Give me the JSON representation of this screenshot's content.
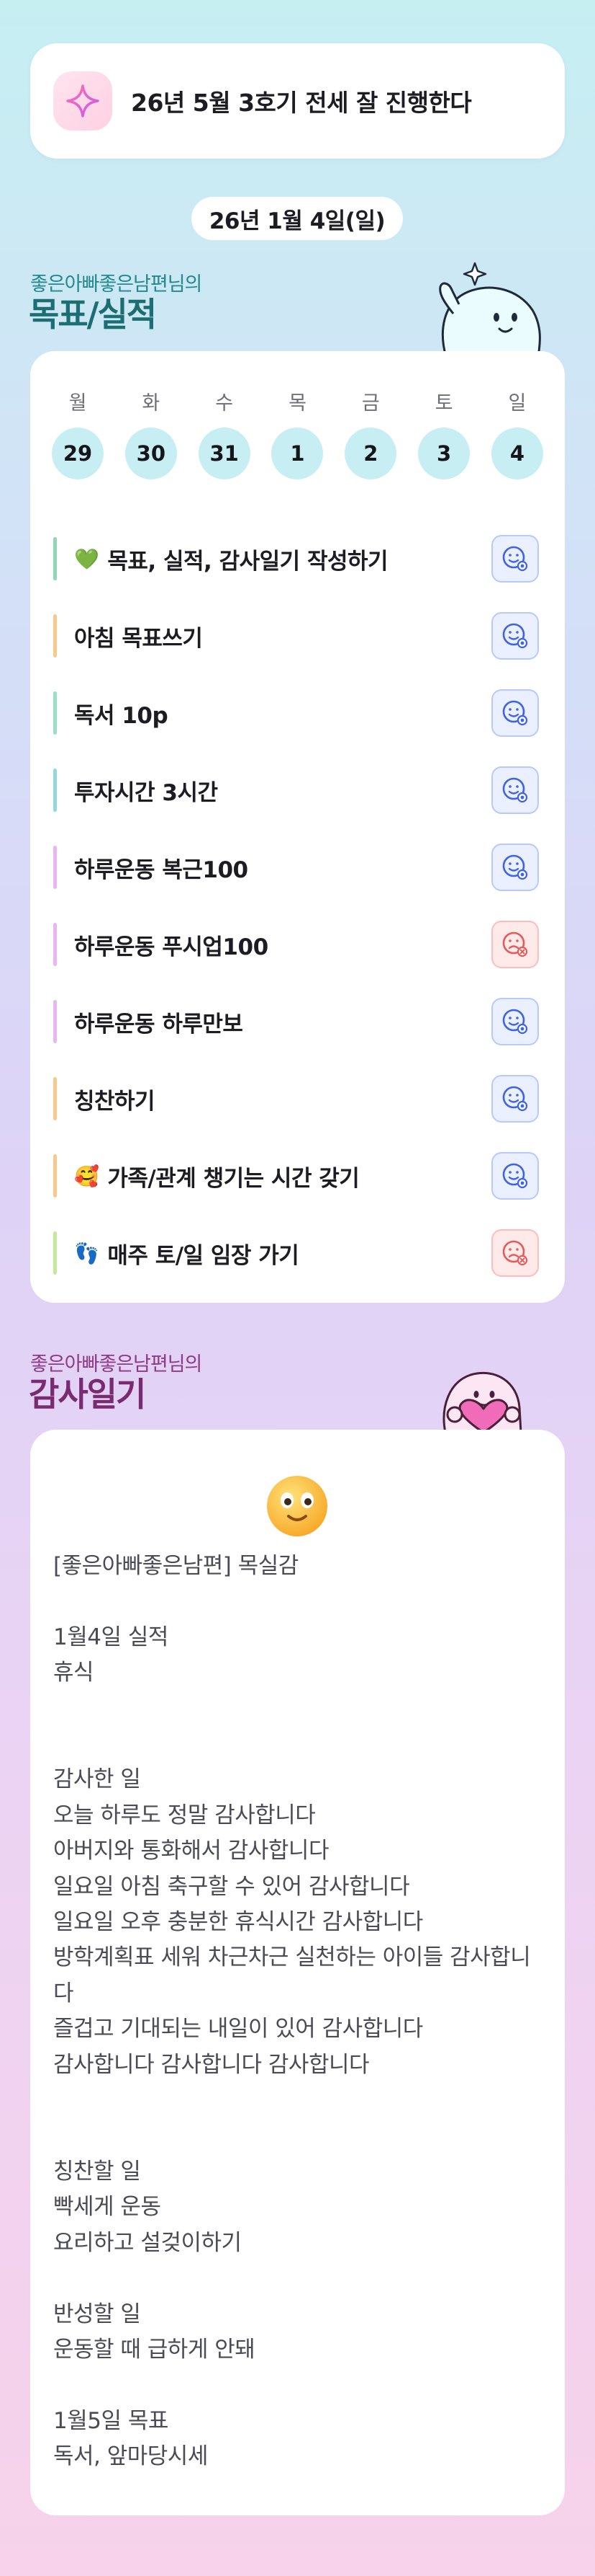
{
  "goal": {
    "icon": "sparkle-icon",
    "text": "26년 5월 3호기 전세 잘 진행한다"
  },
  "date": "26년 1월 4일(일)",
  "goals_section": {
    "subtitle": "좋은아빠좋은남편님의",
    "title": "목표/실적"
  },
  "week": [
    {
      "day": "월",
      "date": "29"
    },
    {
      "day": "화",
      "date": "30"
    },
    {
      "day": "수",
      "date": "31"
    },
    {
      "day": "목",
      "date": "1"
    },
    {
      "day": "금",
      "date": "2"
    },
    {
      "day": "토",
      "date": "3"
    },
    {
      "day": "일",
      "date": "4"
    }
  ],
  "tasks": [
    {
      "emoji": "💚",
      "label": "목표, 실적, 감사일기 작성하기",
      "status": "done",
      "bar_color": "#8fd6b4"
    },
    {
      "emoji": "",
      "label": "아침 목표쓰기",
      "status": "done",
      "bar_color": "#f7c98d"
    },
    {
      "emoji": "",
      "label": "독서 10p",
      "status": "done",
      "bar_color": "#9be0c3"
    },
    {
      "emoji": "",
      "label": "투자시간 3시간",
      "status": "done",
      "bar_color": "#93d6dd"
    },
    {
      "emoji": "",
      "label": "하루운동 복근100",
      "status": "done",
      "bar_color": "#e8b7ef"
    },
    {
      "emoji": "",
      "label": "하루운동 푸시업100",
      "status": "failed",
      "bar_color": "#e8b7ef"
    },
    {
      "emoji": "",
      "label": "하루운동 하루만보",
      "status": "done",
      "bar_color": "#e8b7ef"
    },
    {
      "emoji": "",
      "label": "칭찬하기",
      "status": "done",
      "bar_color": "#f7c98d"
    },
    {
      "emoji": "🥰",
      "label": "가족/관계 챙기는 시간 갖기",
      "status": "done",
      "bar_color": "#f7c98d"
    },
    {
      "emoji": "👣",
      "label": "매주 토/일 임장 가기",
      "status": "failed",
      "bar_color": "#c6e89a"
    }
  ],
  "gratitude_section": {
    "subtitle": "좋은아빠좋은남편님의",
    "title": "감사일기"
  },
  "journal": {
    "mood_icon": "smiley-face-icon",
    "text": "[좋은아빠좋은남편] 목실감\n\n1월4일 실적\n휴식\n\n\n감사한 일\n오늘 하루도 정말 감사합니다\n아버지와 통화해서 감사합니다\n일요일 아침 축구할 수 있어 감사합니다\n일요일 오후 충분한 휴식시간 감사합니다\n방학계획표 세워 차근차근 실천하는 아이들 감사합니다\n즐겁고 기대되는 내일이 있어 감사합니다\n감사합니다 감사합니다 감사합니다\n\n\n칭찬할 일\n빡세게 운동\n요리하고 설겆이하기\n\n반성할 일\n운동할 때 급하게 안돼\n\n1월5일 목표\n독서, 앞마당시세"
  },
  "colors": {
    "accent_teal": "#23898d",
    "accent_purple": "#8e3a84",
    "done_icon": "#3f63e8",
    "fail_icon": "#e85a5a"
  }
}
